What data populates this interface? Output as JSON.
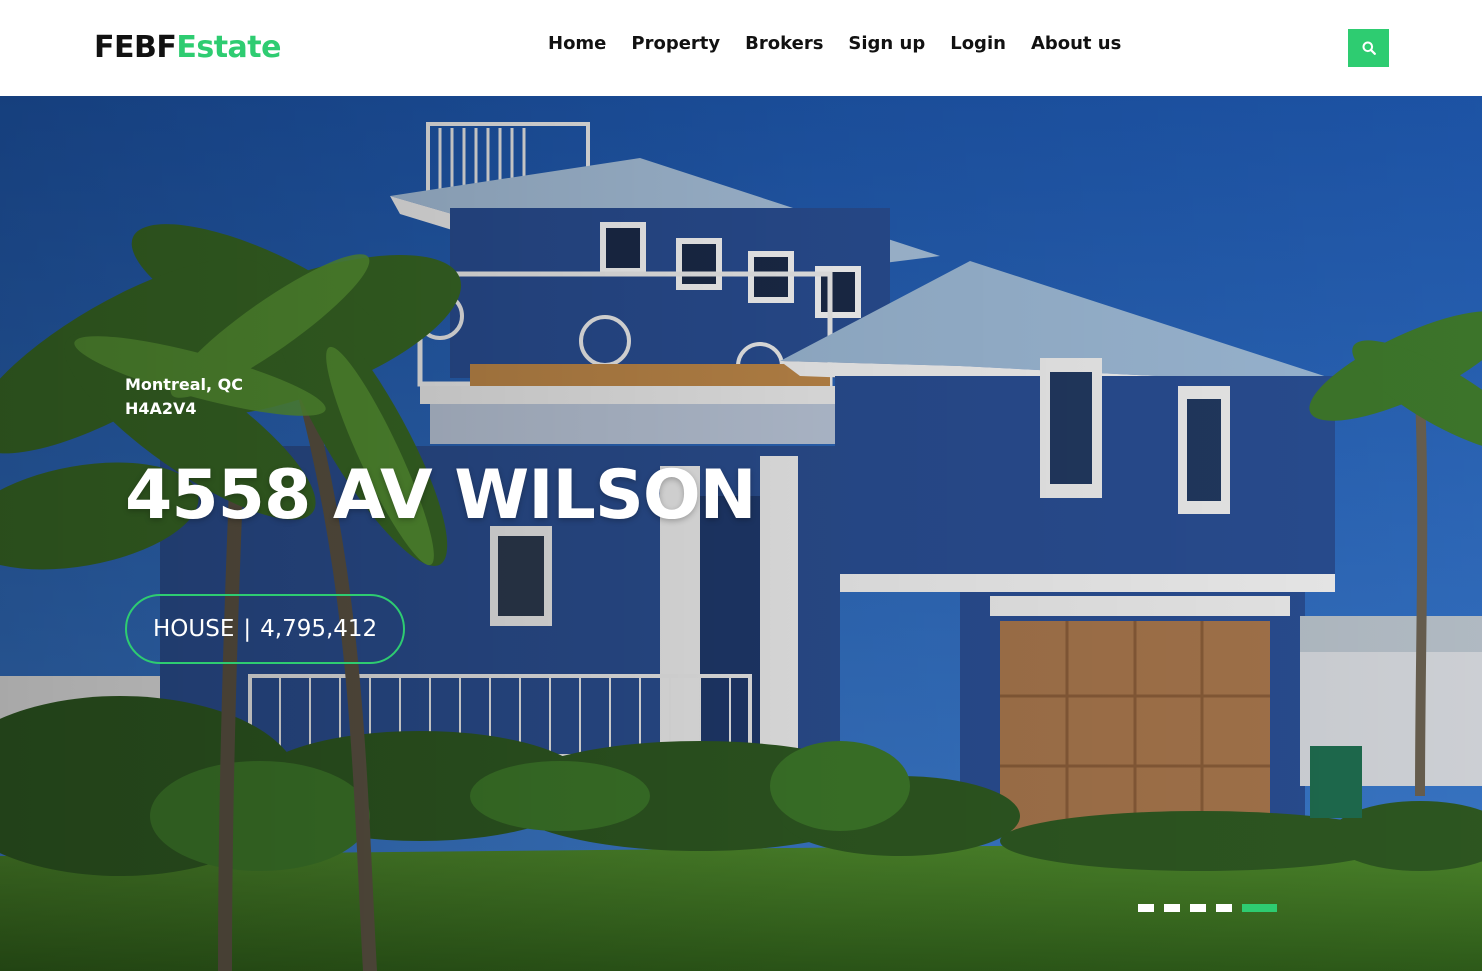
{
  "header": {
    "logo": {
      "part1": "FEBF",
      "part2": "Estate"
    },
    "nav": [
      {
        "label": "Home"
      },
      {
        "label": "Property"
      },
      {
        "label": "Brokers"
      },
      {
        "label": "Sign up"
      },
      {
        "label": "Login"
      },
      {
        "label": "About us"
      }
    ],
    "search_icon": "search-icon"
  },
  "hero": {
    "city": "Montreal, QC",
    "postal_code": "H4A2V4",
    "address": "4558 AV WILSON",
    "property_type": "HOUSE",
    "separator": "|",
    "price": "4,795,412",
    "slider": {
      "count": 5,
      "active_index": 4
    }
  },
  "colors": {
    "accent": "#2ecc71",
    "text_dark": "#111111",
    "text_light": "#ffffff"
  }
}
